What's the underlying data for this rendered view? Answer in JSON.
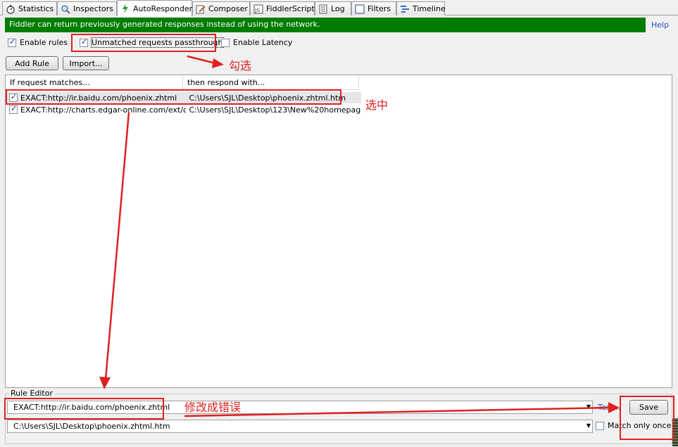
{
  "tabs": [
    {
      "label": "Statistics",
      "icon": "stopwatch-icon"
    },
    {
      "label": "Inspectors",
      "icon": "magnifier-icon"
    },
    {
      "label": "AutoResponder",
      "icon": "lightning-icon",
      "active": true
    },
    {
      "label": "Composer",
      "icon": "pencil-icon"
    },
    {
      "label": "FiddlerScript",
      "icon": "js-icon"
    },
    {
      "label": "Log",
      "icon": "log-icon"
    },
    {
      "label": "Filters",
      "icon": "filter-box-icon"
    },
    {
      "label": "Timeline",
      "icon": "timeline-icon"
    }
  ],
  "banner": {
    "text": "Fiddler can return previously generated responses instead of using the network.",
    "help": "Help",
    "color": "#007c00"
  },
  "options": {
    "enable_rules": {
      "label": "Enable rules",
      "checked": true
    },
    "unmatched_passthrough": {
      "label": "Unmatched requests passthrough",
      "checked": true
    },
    "enable_latency": {
      "label": "Enable Latency",
      "checked": false
    }
  },
  "buttons": {
    "add_rule": "Add Rule",
    "import": "Import..."
  },
  "rules_list": {
    "columns": [
      "If request matches...",
      "then respond with..."
    ],
    "rows": [
      {
        "checked": true,
        "match": "EXACT:http://ir.baidu.com/phoenix.zhtml",
        "respond": "C:\\Users\\SJL\\Desktop\\phoenix.zhtml.htm",
        "selected": true
      },
      {
        "checked": true,
        "match": "EXACT:http://charts.edgar-online.com/ext/c...",
        "respond": "C:\\Users\\SJL\\Desktop\\123\\New%20homepage..."
      }
    ]
  },
  "rule_editor": {
    "title": "Rule Editor",
    "match_value": "EXACT:http://ir.baidu.com/phoenix.zhtml",
    "respond_value": "C:\\Users\\SJL\\Desktop\\phoenix.zhtml.htm",
    "test_link": "Test...",
    "save_label": "Save",
    "match_once": {
      "label": "Match only once",
      "checked": false
    }
  },
  "annotations": {
    "check": "勾选",
    "select": "选中",
    "modify": "修改成错误",
    "color": "#e02020"
  }
}
